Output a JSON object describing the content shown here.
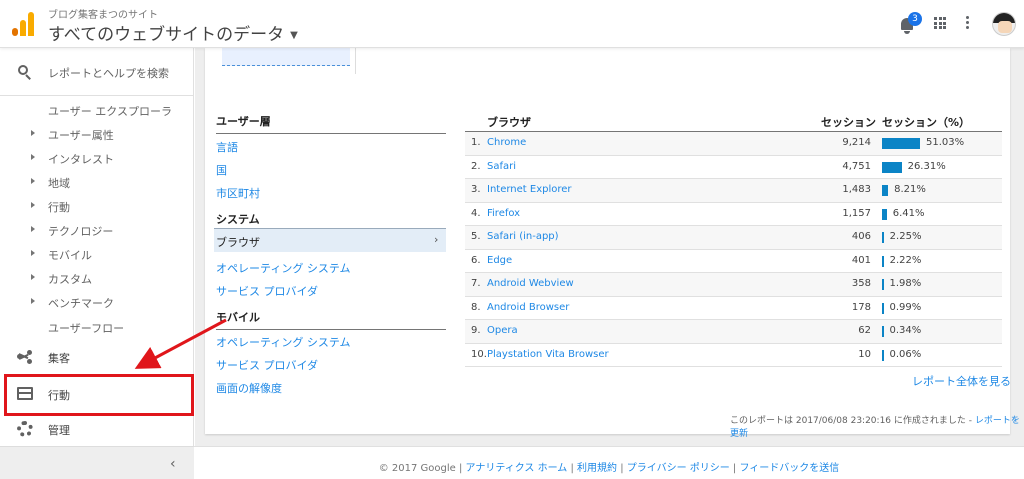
{
  "header": {
    "account": "ブログ集客まつのサイト",
    "property": "すべてのウェブサイトのデータ",
    "notification_count": "3"
  },
  "sidebar": {
    "search_label": "レポートとヘルプを検索",
    "sub_items": [
      {
        "label": "ユーザー エクスプローラ",
        "expandable": false
      },
      {
        "label": "ユーザー属性",
        "expandable": true
      },
      {
        "label": "インタレスト",
        "expandable": true
      },
      {
        "label": "地域",
        "expandable": true
      },
      {
        "label": "行動",
        "expandable": true
      },
      {
        "label": "テクノロジー",
        "expandable": true
      },
      {
        "label": "モバイル",
        "expandable": true
      },
      {
        "label": "カスタム",
        "expandable": true
      },
      {
        "label": "ベンチマーク",
        "expandable": true
      },
      {
        "label": "ユーザーフロー",
        "expandable": false
      }
    ],
    "main_items": [
      {
        "label": "集客",
        "icon": "acquisition-icon"
      },
      {
        "label": "行動",
        "icon": "behavior-icon"
      },
      {
        "label": "管理",
        "icon": "gear-icon"
      }
    ],
    "collapse_icon": "‹",
    "highlight_color": "#e0161b"
  },
  "left_panel": {
    "section_user_attr": "ユーザー層",
    "links_user_attr": [
      "言語",
      "国",
      "市区町村"
    ],
    "section_system": "システム",
    "active_item": "ブラウザ",
    "links_system": [
      "オペレーティング システム",
      "サービス プロバイダ"
    ],
    "section_mobile": "モバイル",
    "links_mobile": [
      "オペレーティング システム",
      "サービス プロバイダ",
      "画面の解像度"
    ]
  },
  "table": {
    "col_browser": "ブラウザ",
    "col_sessions": "セッション",
    "col_sessions_pct": "セッション（%）",
    "rows": [
      {
        "rank": "1.",
        "name": "Chrome",
        "sessions": "9,214",
        "pct": "51.03%",
        "share": 0.5103
      },
      {
        "rank": "2.",
        "name": "Safari",
        "sessions": "4,751",
        "pct": "26.31%",
        "share": 0.2631
      },
      {
        "rank": "3.",
        "name": "Internet Explorer",
        "sessions": "1,483",
        "pct": "8.21%",
        "share": 0.0821
      },
      {
        "rank": "4.",
        "name": "Firefox",
        "sessions": "1,157",
        "pct": "6.41%",
        "share": 0.0641
      },
      {
        "rank": "5.",
        "name": "Safari (in-app)",
        "sessions": "406",
        "pct": "2.25%",
        "share": 0.0225
      },
      {
        "rank": "6.",
        "name": "Edge",
        "sessions": "401",
        "pct": "2.22%",
        "share": 0.0222
      },
      {
        "rank": "7.",
        "name": "Android Webview",
        "sessions": "358",
        "pct": "1.98%",
        "share": 0.0198
      },
      {
        "rank": "8.",
        "name": "Android Browser",
        "sessions": "178",
        "pct": "0.99%",
        "share": 0.0099
      },
      {
        "rank": "9.",
        "name": "Opera",
        "sessions": "62",
        "pct": "0.34%",
        "share": 0.0034
      },
      {
        "rank": "10.",
        "name": "Playstation Vita Browser",
        "sessions": "10",
        "pct": "0.06%",
        "share": 0.0006
      }
    ],
    "bar_color": "#0b84c6",
    "full_report": "レポート全体を見る",
    "created_text": "このレポートは 2017/06/08 23:20:16 に作成されました - ",
    "refresh_link": "レポートを更新"
  },
  "footer": {
    "copyright": "© 2017 Google",
    "links": [
      "アナリティクス ホーム",
      "利用規約",
      "プライバシー ポリシー",
      "フィードバックを送信"
    ]
  }
}
